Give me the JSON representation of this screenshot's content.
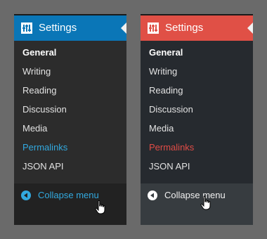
{
  "panels": [
    {
      "theme": "blue",
      "accent": "#0a76b7",
      "link_color": "#32a9df",
      "header_title": "Settings",
      "menu": [
        "General",
        "Writing",
        "Reading",
        "Discussion",
        "Media",
        "Permalinks",
        "JSON API"
      ],
      "active_item": "General",
      "highlighted_item": "Permalinks",
      "collapse_label": "Collapse menu"
    },
    {
      "theme": "red",
      "accent": "#e05046",
      "link_color": "#e04c46",
      "header_title": "Settings",
      "menu": [
        "General",
        "Writing",
        "Reading",
        "Discussion",
        "Media",
        "Permalinks",
        "JSON API"
      ],
      "active_item": "General",
      "highlighted_item": "Permalinks",
      "collapse_label": "Collapse menu"
    }
  ],
  "icons": {
    "header": "settings-icon",
    "collapse": "collapse-arrow-icon",
    "cursor": "hand-pointer-cursor"
  }
}
